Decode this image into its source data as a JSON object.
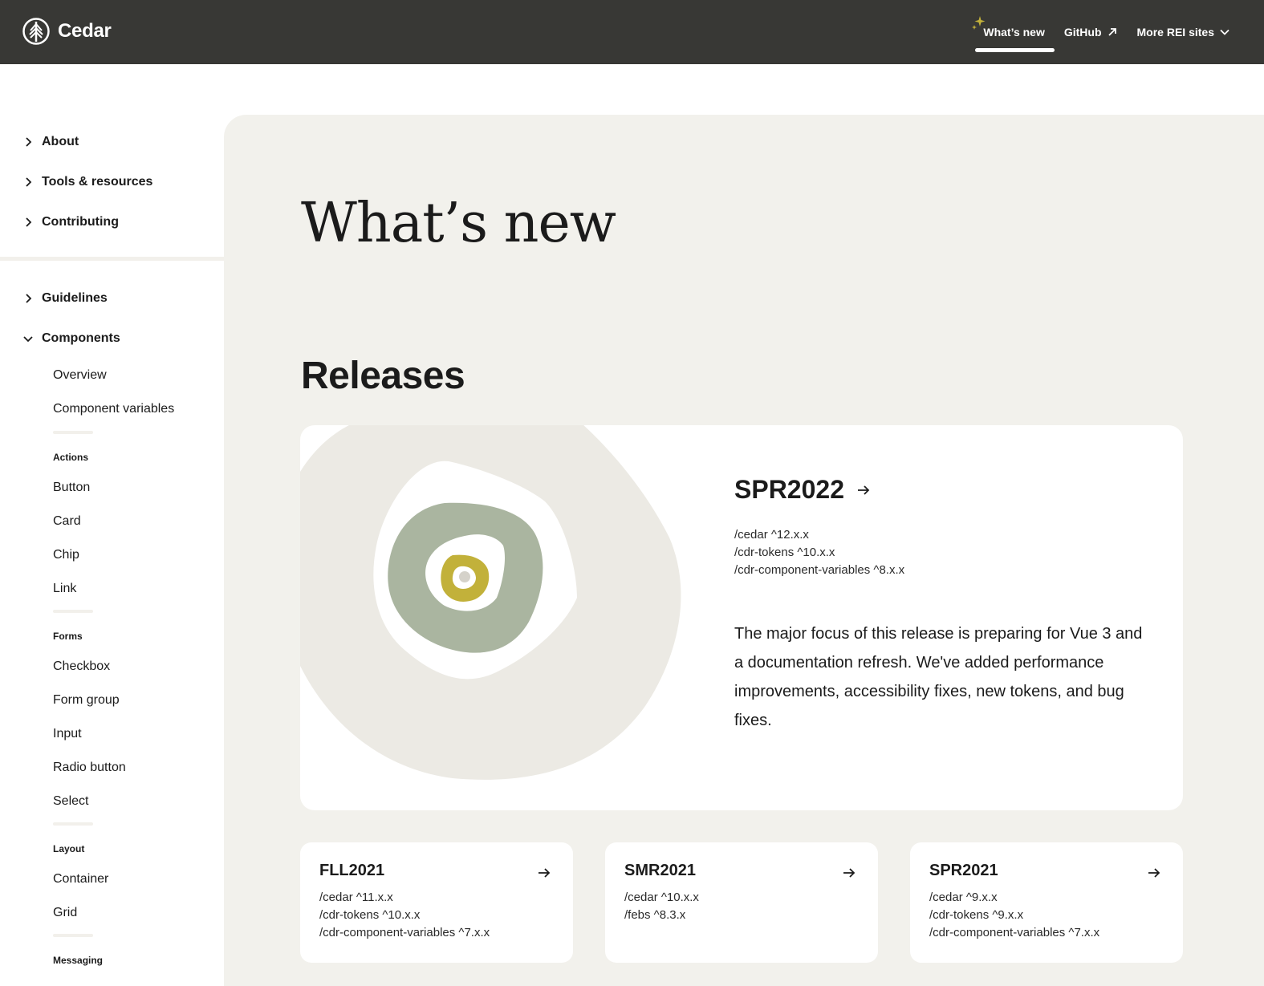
{
  "header": {
    "brand": "Cedar",
    "nav": [
      {
        "label": "What’s new"
      },
      {
        "label": "GitHub"
      },
      {
        "label": "More REI sites"
      }
    ]
  },
  "sidebar": {
    "top_items": [
      "About",
      "Tools & resources",
      "Contributing"
    ],
    "lower_items": [
      "Guidelines",
      "Components"
    ],
    "components": {
      "intro": [
        "Overview",
        "Component variables"
      ],
      "actions_heading": "Actions",
      "actions": [
        "Button",
        "Card",
        "Chip",
        "Link"
      ],
      "forms_heading": "Forms",
      "forms": [
        "Checkbox",
        "Form group",
        "Input",
        "Radio button",
        "Select"
      ],
      "layout_heading": "Layout",
      "layout": [
        "Container",
        "Grid"
      ],
      "messaging_heading": "Messaging"
    }
  },
  "main": {
    "title": "What’s new",
    "section_title": "Releases",
    "featured": {
      "title": "SPR2022",
      "packages": [
        "/cedar ^12.x.x",
        "/cdr-tokens ^10.x.x",
        "/cdr-component-variables ^8.x.x"
      ],
      "description": "The major focus of this release is preparing for Vue 3 and a documentation refresh. We've added performance improvements, accessibility fixes, new tokens, and bug fixes."
    },
    "releases": [
      {
        "title": "FLL2021",
        "packages": [
          "/cedar ^11.x.x",
          "/cdr-tokens ^10.x.x",
          "/cdr-component-variables ^7.x.x"
        ]
      },
      {
        "title": "SMR2021",
        "packages": [
          "/cedar ^10.x.x",
          "/febs ^8.3.x"
        ]
      },
      {
        "title": "SPR2021",
        "packages": [
          "/cedar ^9.x.x",
          "/cdr-tokens ^9.x.x",
          "/cdr-component-variables ^7.x.x"
        ]
      }
    ]
  },
  "colors": {
    "header_bg": "#383835",
    "page_bg": "#f2f1ec",
    "accent_gold": "#c2b13a",
    "sage": "#aab5a0"
  }
}
